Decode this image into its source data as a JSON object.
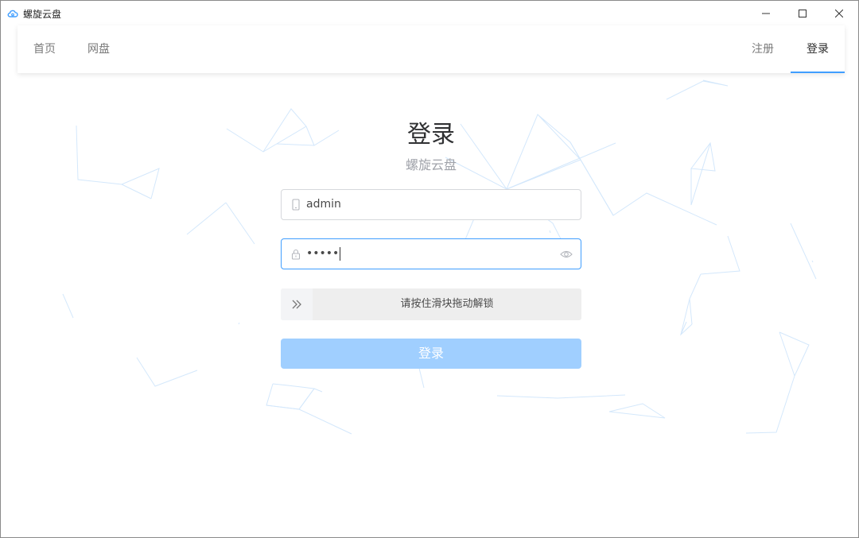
{
  "window": {
    "title": "螺旋云盘"
  },
  "nav": {
    "left": [
      "首页",
      "网盘"
    ],
    "right": [
      "注册",
      "登录"
    ],
    "active": "登录"
  },
  "login": {
    "title": "登录",
    "subtitle": "螺旋云盘",
    "username_value": "admin",
    "password_masked": "•••••",
    "slider_text": "请按住滑块拖动解锁",
    "submit_label": "登录"
  },
  "colors": {
    "accent": "#409eff",
    "button_disabled": "#a0cfff",
    "network_lines": "#cfe5fb"
  },
  "icons": {
    "app": "cloud-icon",
    "username_prefix": "phone-icon",
    "password_prefix": "lock-icon",
    "password_toggle": "eye-icon",
    "slider_handle": "double-chevron-right-icon"
  }
}
